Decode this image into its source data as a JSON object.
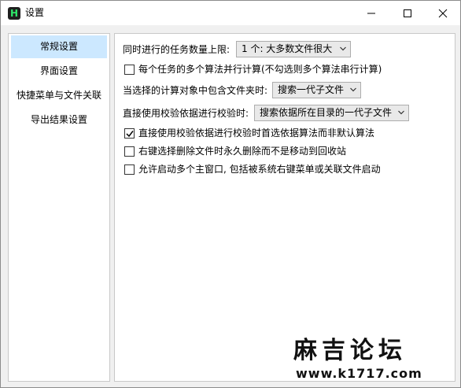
{
  "window": {
    "title": "设置",
    "app_icon_letter": "H"
  },
  "sidebar": {
    "items": [
      {
        "label": "常规设置",
        "active": true
      },
      {
        "label": "界面设置",
        "active": false
      },
      {
        "label": "快捷菜单与文件关联",
        "active": false
      },
      {
        "label": "导出结果设置",
        "active": false
      }
    ]
  },
  "settings": {
    "concurrent_label": "同时进行的任务数量上限:",
    "concurrent_value": "1 个: 大多数文件很大",
    "parallel_algorithms": {
      "label": "每个任务的多个算法并行计算(不勾选则多个算法串行计算)",
      "checked": false
    },
    "folder_label": "当选择的计算对象中包含文件夹时:",
    "folder_value": "搜索一代子文件",
    "verify_label": "直接使用校验依据进行校验时:",
    "verify_value": "搜索依据所在目录的一代子文件",
    "verify_prefer_algo": {
      "label": "直接使用校验依据进行校验时首选依据算法而非默认算法",
      "checked": true
    },
    "permanent_delete": {
      "label": "右键选择删除文件时永久删除而不是移动到回收站",
      "checked": false
    },
    "multi_window": {
      "label": "允许启动多个主窗口, 包括被系统右键菜单或关联文件启动",
      "checked": false
    }
  },
  "watermark": {
    "line1": "麻吉论坛",
    "line2": "www.k1717.com"
  }
}
